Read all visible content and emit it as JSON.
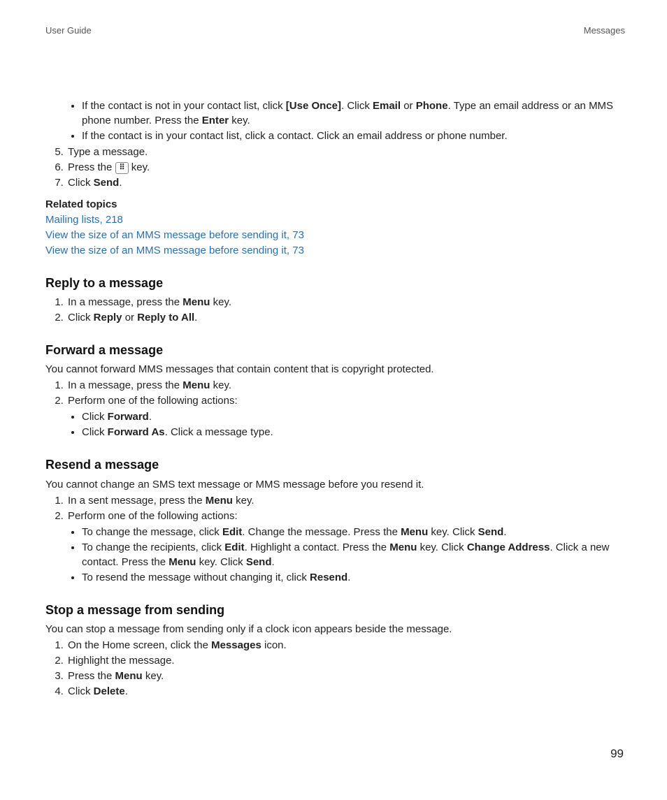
{
  "header": {
    "left": "User Guide",
    "right": "Messages"
  },
  "intro_bullets": [
    {
      "pre": "If the contact is not in your contact list, click ",
      "b1": "[Use Once]",
      "mid1": ". Click ",
      "b2": "Email",
      "mid2": " or ",
      "b3": "Phone",
      "mid3": ". Type an email address or an MMS phone number. Press the ",
      "b4": "Enter",
      "post": " key."
    },
    {
      "text": "If the contact is in your contact list, click a contact. Click an email address or phone number."
    }
  ],
  "intro_ol": {
    "start": 5,
    "items": [
      {
        "text": "Type a message."
      },
      {
        "pre": "Press the ",
        "icon": "⠿",
        "post": " key."
      },
      {
        "pre": "Click ",
        "b": "Send",
        "post": "."
      }
    ]
  },
  "related": {
    "label": "Related topics",
    "links": [
      "Mailing lists, 218",
      "View the size of an MMS message before sending it, 73",
      "View the size of an MMS message before sending it, 73"
    ]
  },
  "sec_reply": {
    "title": "Reply to a message",
    "items": [
      {
        "pre": "In a message, press the ",
        "b": "Menu",
        "post": " key."
      },
      {
        "pre": "Click ",
        "b1": "Reply",
        "mid": " or ",
        "b2": "Reply to All",
        "post": "."
      }
    ]
  },
  "sec_forward": {
    "title": "Forward a message",
    "note": "You cannot forward MMS messages that contain content that is copyright protected.",
    "items": [
      {
        "pre": "In a message, press the ",
        "b": "Menu",
        "post": " key."
      },
      {
        "text": "Perform one of the following actions:"
      }
    ],
    "sub": [
      {
        "pre": "Click ",
        "b": "Forward",
        "post": "."
      },
      {
        "pre": "Click ",
        "b": "Forward As",
        "post": ". Click a message type."
      }
    ]
  },
  "sec_resend": {
    "title": "Resend a message",
    "note": "You cannot change an SMS text message or MMS message before you resend it.",
    "items": [
      {
        "pre": "In a sent message, press the ",
        "b": "Menu",
        "post": " key."
      },
      {
        "text": "Perform one of the following actions:"
      }
    ],
    "sub": [
      {
        "pre": "To change the message, click ",
        "b1": "Edit",
        "mid1": ". Change the message. Press the ",
        "b2": "Menu",
        "mid2": " key. Click ",
        "b3": "Send",
        "post": "."
      },
      {
        "pre": "To change the recipients, click ",
        "b1": "Edit",
        "mid1": ". Highlight a contact. Press the ",
        "b2": "Menu",
        "mid2": " key. Click ",
        "b3": "Change Address",
        "mid3": ". Click a new contact. Press the ",
        "b4": "Menu",
        "mid4": " key. Click ",
        "b5": "Send",
        "post": "."
      },
      {
        "pre": "To resend the message without changing it, click ",
        "b": "Resend",
        "post": "."
      }
    ]
  },
  "sec_stop": {
    "title": "Stop a message from sending",
    "note": "You can stop a message from sending only if a clock icon appears beside the message.",
    "items": [
      {
        "pre": "On the Home screen, click the ",
        "b": "Messages",
        "post": " icon."
      },
      {
        "text": "Highlight the message."
      },
      {
        "pre": "Press the ",
        "b": "Menu",
        "post": " key."
      },
      {
        "pre": "Click ",
        "b": "Delete",
        "post": "."
      }
    ]
  },
  "page_number": "99"
}
